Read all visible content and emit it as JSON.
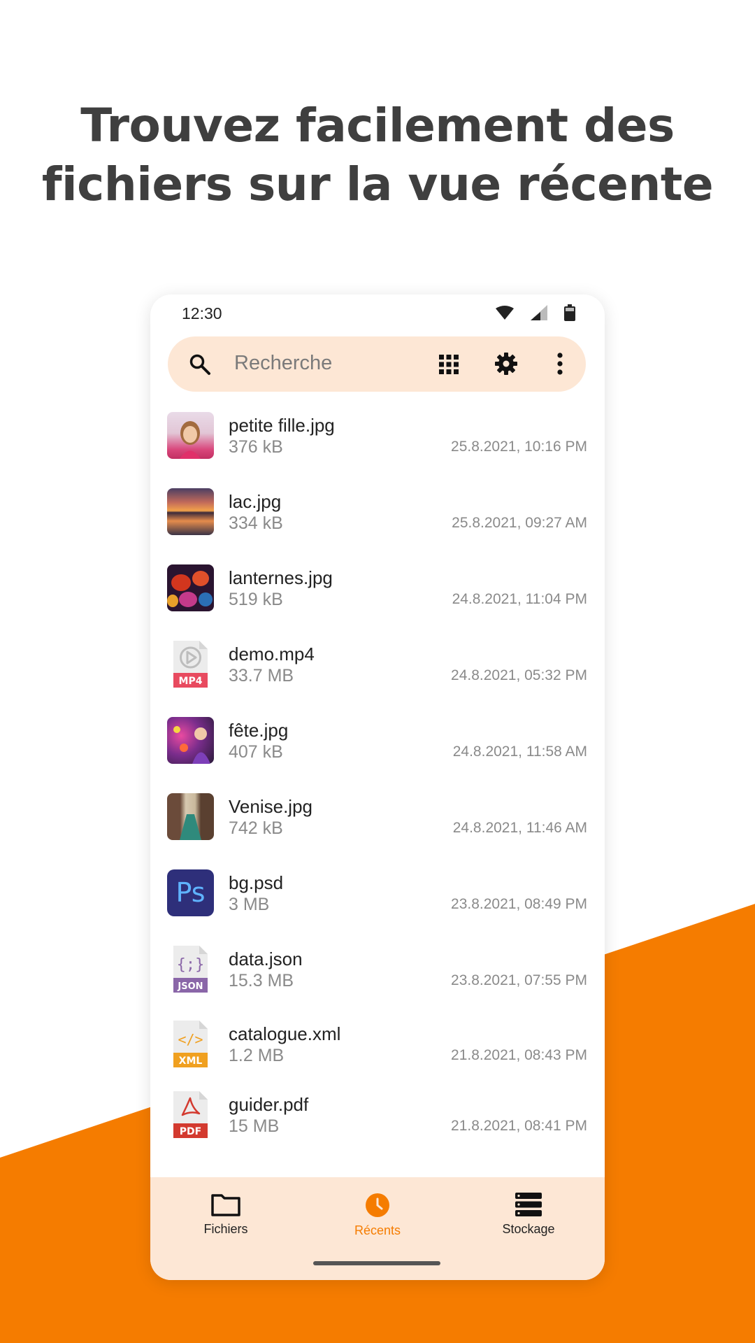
{
  "headline": {
    "line1": "Trouvez facilement des",
    "line2": "fichiers sur la vue récente"
  },
  "status_bar": {
    "time": "12:30"
  },
  "search": {
    "placeholder": "Recherche"
  },
  "colors": {
    "accent": "#f57c00",
    "surface": "#fde7d5"
  },
  "files": [
    {
      "name": "petite fille.jpg",
      "size": "376 kB",
      "date": "25.8.2021, 10:16 PM",
      "icon": "photo-girl-icon"
    },
    {
      "name": "lac.jpg",
      "size": "334 kB",
      "date": "25.8.2021, 09:27 AM",
      "icon": "photo-lake-icon"
    },
    {
      "name": "lanternes.jpg",
      "size": "519 kB",
      "date": "24.8.2021, 11:04 PM",
      "icon": "photo-lanterns-icon"
    },
    {
      "name": "demo.mp4",
      "size": "33.7 MB",
      "date": "24.8.2021, 05:32 PM",
      "icon": "mp4-file-icon",
      "badge": "MP4"
    },
    {
      "name": "fête.jpg",
      "size": "407 kB",
      "date": "24.8.2021, 11:58 AM",
      "icon": "photo-party-icon"
    },
    {
      "name": "Venise.jpg",
      "size": "742 kB",
      "date": "24.8.2021, 11:46 AM",
      "icon": "photo-venice-icon"
    },
    {
      "name": "bg.psd",
      "size": "3 MB",
      "date": "23.8.2021, 08:49 PM",
      "icon": "psd-file-icon",
      "badge": "Ps"
    },
    {
      "name": "data.json",
      "size": "15.3 MB",
      "date": "23.8.2021, 07:55 PM",
      "icon": "json-file-icon",
      "badge": "JSON"
    },
    {
      "name": "catalogue.xml",
      "size": "1.2 MB",
      "date": "21.8.2021, 08:43 PM",
      "icon": "xml-file-icon",
      "badge": "XML"
    },
    {
      "name": "guider.pdf",
      "size": "15 MB",
      "date": "21.8.2021, 08:41 PM",
      "icon": "pdf-file-icon",
      "badge": "PDF"
    }
  ],
  "nav": {
    "files": "Fichiers",
    "recent": "Récents",
    "storage": "Stockage"
  }
}
